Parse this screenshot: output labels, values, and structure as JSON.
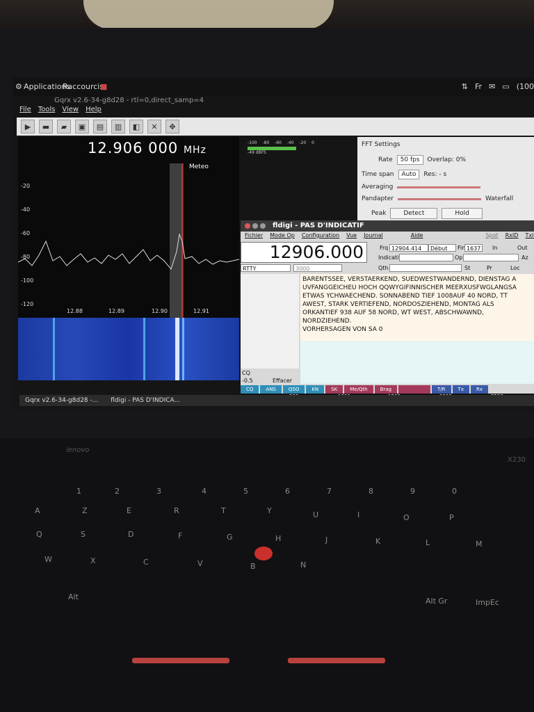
{
  "topbar": {
    "applications": "Applications",
    "raccourcis": "Raccourcis",
    "tray_lang": "Fr",
    "tray_time": "(100"
  },
  "gqrx": {
    "title": "Gqrx v2.6-34-g8d28 - rtl=0,direct_samp=4",
    "menu": [
      "File",
      "Tools",
      "View",
      "Help"
    ],
    "frequency": "12.906 000",
    "frequency_unit": "MHz",
    "marker_label": "Meteo",
    "y_ticks": [
      "-20",
      "-40",
      "-60",
      "-80",
      "-100",
      "-120"
    ],
    "x_ticks": [
      "12.88",
      "12.89",
      "12.90",
      "12.91"
    ],
    "meter_ticks": [
      "-100",
      "-80",
      "-60",
      "-40",
      "-20",
      "0"
    ],
    "meter_label": "-49 dBFS",
    "fft": {
      "title": "FFT Settings",
      "rate_label": "Rate",
      "rate_value": "50 fps",
      "overlap": "Overlap: 0%",
      "timespan_label": "Time span",
      "timespan_value": "Auto",
      "res": "Res: - s",
      "averaging": "Averaging",
      "pandapter": "Pandapter",
      "waterfall": "Waterfall",
      "peak": "Peak",
      "detect": "Detect",
      "hold": "Hold"
    }
  },
  "fldigi": {
    "title": "fldigi - PAS D'INDICATIF",
    "menu": [
      "Fichier",
      "Mode Op",
      "Configuration",
      "Vue",
      "Journal",
      "Aide"
    ],
    "spot": "Spot",
    "rxid": "RxID",
    "txid": "TxID",
    "frequency": "12906.000",
    "frq_label": "Frq",
    "frq_value": "12904.414",
    "debut": "Début",
    "fin_label": "Fin",
    "fin_value": "1637",
    "in": "In",
    "out": "Out",
    "indicatif": "Indicatif",
    "op": "Op",
    "az": "Az",
    "qth": "Qth",
    "st": "St",
    "pr": "Pr",
    "loc": "Loc",
    "mode": "RTTY",
    "offset": "3000",
    "cq": "CQ",
    "level": "-0.5",
    "effacer": "Effacer",
    "rx_text": "BARENTSSEE, VERSTAERKEND, SUEDWESTWANDERND, DIENSTAG A\nUVFANGGEICHEU HOCH QQWYGIFINNISCHER MEERXUSFWGLANGSA\nETWAS YCHWAECHEND. SONNABEND TIEF 1008AUF 40 NORD, TT\nAWEST, STARK VERTIEFEND, NORDOSZIEHEND, MONTAG ALS\nORKANTIEF 938 AUF 58 NORD, WT WEST, ABSCHWAWND,\nNORDZIEHEND.\nVORHERSAGEN VON SA 0",
    "macros": [
      "CQ",
      "ANS",
      "QSO",
      "KN",
      "SK",
      "Me/Qth",
      "Brag",
      "",
      "T/R",
      "Tx",
      "Rx"
    ],
    "scale": [
      "500",
      "1000",
      "1500",
      "2000",
      "2500"
    ]
  },
  "taskbar": {
    "item1": "Gqrx v2.6-34-g8d28 -...",
    "item2": "fldigi - PAS D'INDICA..."
  },
  "laptop": {
    "brand": "lenovo",
    "model": "X230"
  },
  "keys": [
    "1",
    "2",
    "3",
    "4",
    "5",
    "6",
    "7",
    "8",
    "9",
    "0",
    "A",
    "Z",
    "E",
    "R",
    "T",
    "Y",
    "U",
    "I",
    "O",
    "P",
    "Q",
    "S",
    "D",
    "F",
    "G",
    "H",
    "J",
    "K",
    "L",
    "M",
    "W",
    "X",
    "C",
    "V",
    "B",
    "N",
    "Alt",
    "Alt Gr",
    "ImpEc"
  ]
}
